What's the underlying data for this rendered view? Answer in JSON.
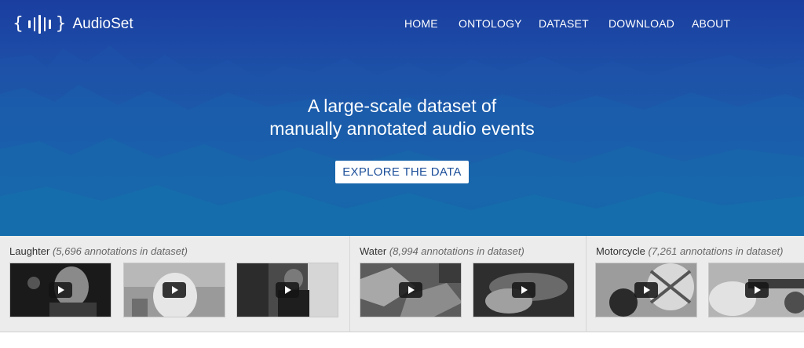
{
  "brand": {
    "name": "AudioSet",
    "logo_icon": "waveform-icon",
    "brace_open": "{",
    "brace_close": "}"
  },
  "nav": {
    "items": [
      "HOME",
      "ONTOLOGY",
      "DATASET",
      "DOWNLOAD",
      "ABOUT"
    ]
  },
  "hero": {
    "line1": "A large-scale dataset of",
    "line2": "manually annotated audio events",
    "cta_label": "EXPLORE THE DATA"
  },
  "samples": [
    {
      "label": "Laughter",
      "count_text": "(5,696 annotations in dataset)",
      "videos": 3
    },
    {
      "label": "Water",
      "count_text": "(8,994 annotations in dataset)",
      "videos": 2
    },
    {
      "label": "Motorcycle",
      "count_text": "(7,261 annotations in dataset)",
      "videos": 2
    }
  ],
  "colors": {
    "hero_top": "#1a3ea0",
    "hero_bottom": "#1472a8",
    "cta_text": "#1d4f9a",
    "samples_bg": "#ececec"
  },
  "icons": {
    "play": "play-icon"
  }
}
